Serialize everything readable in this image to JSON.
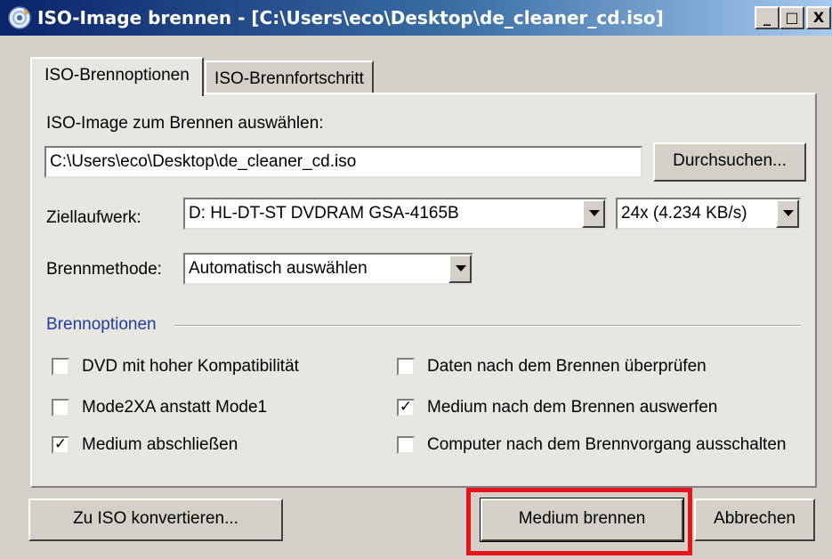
{
  "window": {
    "title": "ISO-Image brennen - [C:\\Users\\eco\\Desktop\\de_cleaner_cd.iso]",
    "controls": {
      "minimize": "_",
      "maximize": "□",
      "close": "X"
    }
  },
  "tabs": [
    {
      "label": "ISO-Brennoptionen",
      "active": true
    },
    {
      "label": "ISO-Brennfortschritt",
      "active": false
    }
  ],
  "iso_select": {
    "label": "ISO-Image zum Brennen auswählen:",
    "path_value": "C:\\Users\\eco\\Desktop\\de_cleaner_cd.iso",
    "browse_label": "Durchsuchen..."
  },
  "target_drive": {
    "label": "Ziellaufwerk:",
    "drive_value": "D: HL-DT-ST DVDRAM GSA-4165B",
    "speed_value": "24x (4.234 KB/s)"
  },
  "burn_method": {
    "label": "Brennmethode:",
    "value": "Automatisch auswählen"
  },
  "burn_options": {
    "group_label": "Brennoptionen",
    "items": [
      {
        "label": "DVD mit hoher Kompatibilität",
        "checked": false
      },
      {
        "label": "Daten nach dem Brennen überprüfen",
        "checked": false
      },
      {
        "label": "Mode2XA anstatt Mode1",
        "checked": false
      },
      {
        "label": "Medium nach dem Brennen auswerfen",
        "checked": true
      },
      {
        "label": "Medium abschließen",
        "checked": true
      },
      {
        "label": "Computer nach dem Brennvorgang ausschalten",
        "checked": false
      }
    ]
  },
  "footer": {
    "convert_label": "Zu ISO konvertieren...",
    "burn_label": "Medium brennen",
    "cancel_label": "Abbrechen"
  },
  "colors": {
    "titlebar_start": "#0a246a",
    "titlebar_end": "#a6caf0",
    "group_label": "#1f3d9c",
    "highlight": "#e8141b"
  }
}
